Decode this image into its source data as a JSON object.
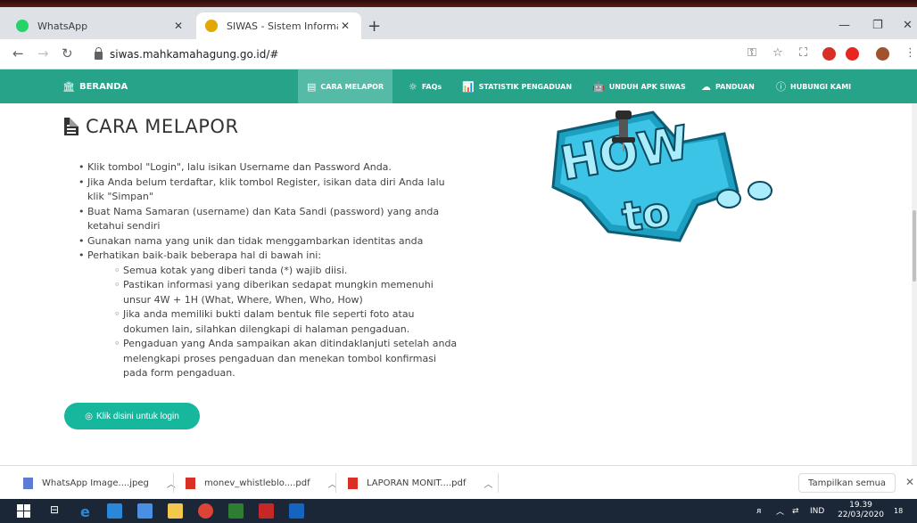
{
  "browser": {
    "tabs": [
      {
        "title": "WhatsApp",
        "favicon": "whatsapp-icon",
        "color": "#25d366"
      },
      {
        "title": "SIWAS - Sistem Informasi Pengad",
        "favicon": "siwas-logo-icon",
        "color": "#e0a800"
      }
    ],
    "new_tab": "+",
    "url": "siwas.mahkamahagung.go.id/#"
  },
  "nav": {
    "items": [
      {
        "label": "BERANDA",
        "icon": "bank-icon",
        "glyph": "🏛"
      },
      {
        "label": "CARA MELAPOR",
        "icon": "list-icon",
        "glyph": "▤"
      },
      {
        "label": "FAQs",
        "icon": "lightbulb-icon",
        "glyph": "☼"
      },
      {
        "label": "STATISTIK PENGADUAN",
        "icon": "bar-chart-icon",
        "glyph": "📊"
      },
      {
        "label": "UNDUH APK SIWAS",
        "icon": "android-icon",
        "glyph": "🤖"
      },
      {
        "label": "PANDUAN",
        "icon": "cloud-download-icon",
        "glyph": "☁"
      },
      {
        "label": "HUBUNGI KAMI",
        "icon": "info-icon",
        "glyph": "ⓘ"
      }
    ],
    "active_color": "#55bba6",
    "bar_color": "#27a38a"
  },
  "main": {
    "title": "CARA MELAPOR",
    "bullets": [
      "Klik tombol \"Login\", lalu isikan Username dan Password Anda.",
      "Jika Anda belum terdaftar, klik tombol Register, isikan data diri Anda lalu klik \"Simpan\"",
      "Buat Nama Samaran (username) dan Kata Sandi (password) yang anda ketahui sendiri",
      "Gunakan nama yang unik dan tidak menggambarkan identitas anda",
      "Perhatikan baik-baik beberapa hal di bawah ini:"
    ],
    "sub_bullets": [
      "Semua kotak yang diberi tanda (*) wajib diisi.",
      "Pastikan informasi yang diberikan sedapat mungkin memenuhi unsur 4W + 1H (What, Where, When, Who, How)",
      "Jika anda memiliki bukti dalam bentuk file seperti foto atau dokumen lain, silahkan dilengkapi di halaman pengaduan.",
      "Pengaduan yang Anda sampaikan akan ditindaklanjuti setelah anda melengkapi proses pengaduan dan menekan tombol konfirmasi pada form pengaduan."
    ],
    "login_button": "Klik disini untuk login",
    "howto_image": {
      "line1": "HOW",
      "line2": "to"
    }
  },
  "downloads": {
    "items": [
      {
        "name": "WhatsApp Image....jpeg",
        "icon": "image-file-icon"
      },
      {
        "name": "monev_whistleblo....pdf",
        "icon": "pdf-file-icon"
      },
      {
        "name": "LAPORAN MONIT....pdf",
        "icon": "pdf-file-icon"
      }
    ],
    "show_all": "Tampilkan semua"
  },
  "taskbar": {
    "language": "IND",
    "time": "19.39",
    "date": "22/03/2020",
    "notification_count": "18"
  }
}
